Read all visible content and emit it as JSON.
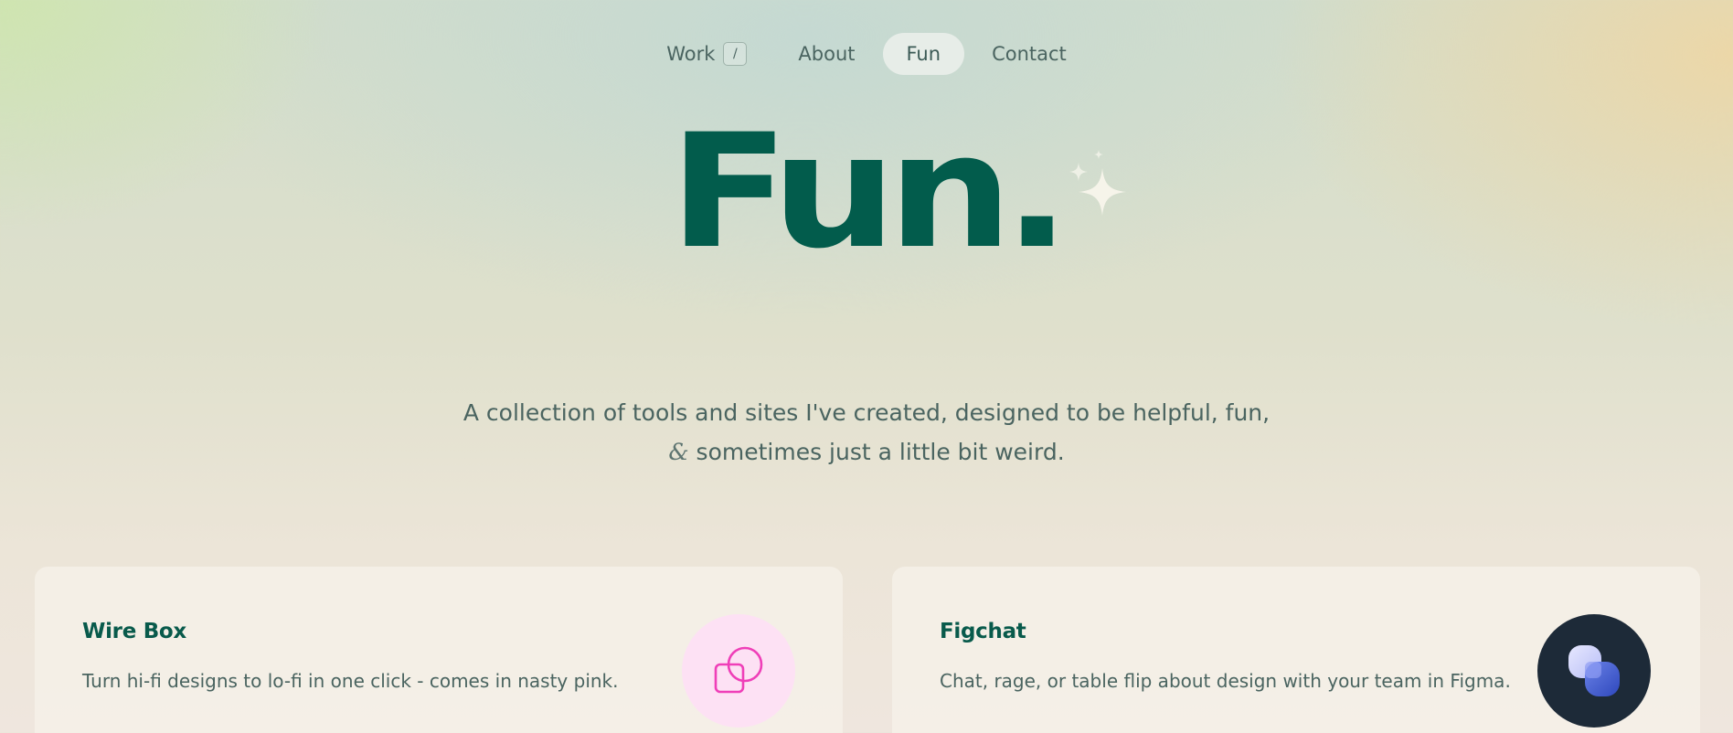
{
  "nav": {
    "items": [
      {
        "label": "Work",
        "shortcut": "/"
      },
      {
        "label": "About"
      },
      {
        "label": "Fun",
        "active": true
      },
      {
        "label": "Contact"
      }
    ]
  },
  "hero": {
    "title": "Fun.",
    "subtitle_line1": "A collection of tools and sites I've created, designed to be helpful, fun,",
    "subtitle_amp": "&",
    "subtitle_line2": " sometimes just a little bit weird."
  },
  "cards": [
    {
      "title": "Wire Box",
      "description": "Turn hi-fi designs to lo-fi in one click - comes in nasty pink.",
      "icon": "wire-box-icon",
      "icon_bg": "#fde1f4"
    },
    {
      "title": "Figchat",
      "description": "Chat, rage, or table flip about design with your team in Figma.",
      "icon": "figchat-icon",
      "icon_bg": "#1d2a38"
    }
  ],
  "colors": {
    "brand": "#025c4c",
    "text": "#4a6460",
    "wirebox_pink": "#ef3fb8",
    "figchat_blue": "#3f5fd8"
  }
}
